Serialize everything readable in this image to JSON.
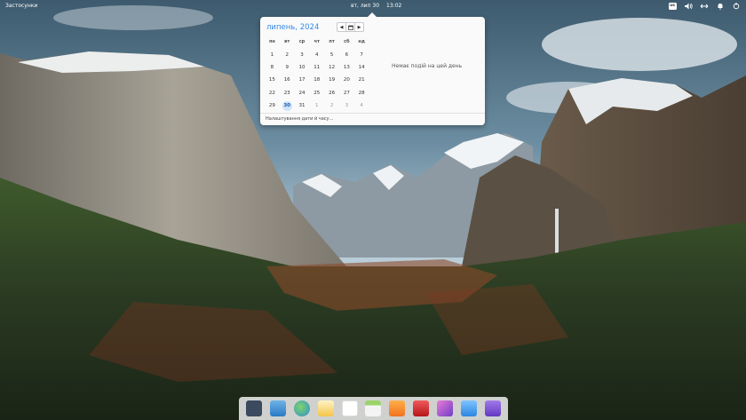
{
  "panel": {
    "applications_label": "Застосунки",
    "date": "вт, лип 30",
    "time": "13:02",
    "keyboard_layout": "us",
    "indicators": [
      "keyboard-layout-icon",
      "volume-icon",
      "network-icon",
      "notifications-icon",
      "power-icon"
    ]
  },
  "calendar": {
    "month_title": "липень, 2024",
    "weekdays": [
      "пн",
      "вт",
      "ср",
      "чт",
      "пт",
      "сб",
      "нд"
    ],
    "weeks": [
      [
        "1",
        "2",
        "3",
        "4",
        "5",
        "6",
        "7"
      ],
      [
        "8",
        "9",
        "10",
        "11",
        "12",
        "13",
        "14"
      ],
      [
        "15",
        "16",
        "17",
        "18",
        "19",
        "20",
        "21"
      ],
      [
        "22",
        "23",
        "24",
        "25",
        "26",
        "27",
        "28"
      ],
      [
        "29",
        "30",
        "31",
        "1",
        "2",
        "3",
        "4"
      ]
    ],
    "today": "30",
    "no_events_text": "Немає подій на цей день",
    "settings_link": "Налаштування дати й часу…"
  },
  "dock": {
    "apps": [
      "multitasking-view-icon",
      "files-icon",
      "web-browser-icon",
      "mail-icon",
      "tasks-icon",
      "calendar-app-icon",
      "music-icon",
      "videos-icon",
      "photos-icon",
      "app-center-icon",
      "system-settings-icon"
    ]
  },
  "colors": {
    "accent": "#3689e6",
    "popover_bg": "#fafafa"
  }
}
